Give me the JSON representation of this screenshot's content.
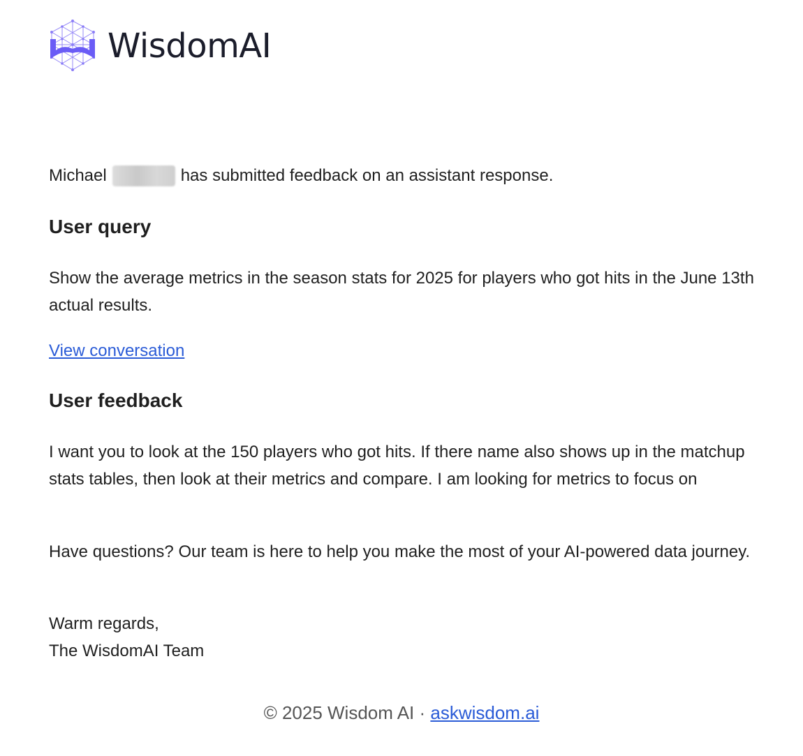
{
  "brand": {
    "name": "WisdomAI",
    "logo_icon": "hexagon-network-logo-icon",
    "accent_color": "#6a5cf6"
  },
  "intro": {
    "first_name": "Michael",
    "message": "has submitted feedback on an assistant response."
  },
  "query": {
    "heading": "User query",
    "text": "Show the average metrics in the season stats for 2025 for players who got hits in the June 13th actual results.",
    "link_label": "View conversation"
  },
  "feedback": {
    "heading": "User feedback",
    "text": "I want you to look at the 150 players who got hits. If there name also shows up in the matchup stats tables, then look at their metrics and compare. I am looking for metrics to focus on"
  },
  "closing": {
    "questions": "Have questions? Our team is here to help you make the most of your AI-powered data journey.",
    "regards": "Warm regards,",
    "signature": "The WisdomAI Team"
  },
  "footer": {
    "copyright": "© 2025 Wisdom AI · ",
    "link_label": "askwisdom.ai"
  },
  "colors": {
    "text": "#1f1f1f",
    "link": "#2a5bd7",
    "footer_text": "#555555"
  }
}
